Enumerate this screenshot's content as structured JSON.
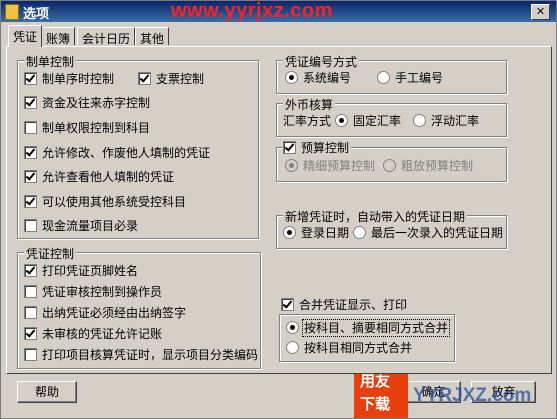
{
  "window": {
    "title": "选项",
    "watermark_top": "www.yyrjxz.com"
  },
  "tabs": [
    {
      "label": "凭证",
      "active": true
    },
    {
      "label": "账簿"
    },
    {
      "label": "会计日历"
    },
    {
      "label": "其他"
    }
  ],
  "make_control": {
    "title": "制单控制",
    "items": [
      {
        "label": "制单序时控制",
        "checked": true
      },
      {
        "label": "支票控制",
        "checked": true
      },
      {
        "label": "资金及往来赤字控制",
        "checked": true
      },
      {
        "label": "制单权限控制到科目",
        "checked": false
      },
      {
        "label": "允许修改、作废他人填制的凭证",
        "checked": true
      },
      {
        "label": "允许查看他人填制的凭证",
        "checked": true
      },
      {
        "label": "可以使用其他系统受控科目",
        "checked": true
      },
      {
        "label": "现金流量项目必录",
        "checked": false
      }
    ]
  },
  "voucher_control": {
    "title": "凭证控制",
    "items": [
      {
        "label": "打印凭证页脚姓名",
        "checked": true
      },
      {
        "label": "凭证审核控制到操作员",
        "checked": false
      },
      {
        "label": "出纳凭证必须经由出纳签字",
        "checked": false
      },
      {
        "label": "未审核的凭证允许记账",
        "checked": true
      },
      {
        "label": "打印项目核算凭证时，显示项目分类编码",
        "checked": false
      }
    ]
  },
  "numbering": {
    "title": "凭证编号方式",
    "options": [
      "系统编号",
      "手工编号"
    ],
    "selected": "系统编号"
  },
  "fx": {
    "title": "外币核算",
    "label": "汇率方式",
    "options": [
      "固定汇率",
      "浮动汇率"
    ],
    "selected": "固定汇率"
  },
  "budget": {
    "label": "预算控制",
    "checked": true,
    "options": [
      "精细预算控制",
      "粗放预算控制"
    ],
    "selected": "精细预算控制"
  },
  "new_voucher_date": {
    "title": "新增凭证时，自动带入的凭证日期",
    "options": [
      "登录日期",
      "最后一次录入的凭证日期"
    ],
    "selected": "登录日期"
  },
  "merge": {
    "label": "合并凭证显示、打印",
    "checked": true,
    "options": [
      "按科目、摘要相同方式合并",
      "按科目相同方式合并"
    ],
    "selected": "按科目、摘要相同方式合并"
  },
  "buttons": {
    "help": "帮助",
    "ok": "确定",
    "cancel": "放弃"
  },
  "watermark": {
    "logo_top": "用友",
    "logo_bottom": "下载",
    "site": "YYRJXZ.com"
  },
  "colors": {
    "title_bar": "#0a246a",
    "dialog_bg": "#d4d0c8",
    "highlight": "#e02020",
    "watermark_red": "#ff2020"
  }
}
